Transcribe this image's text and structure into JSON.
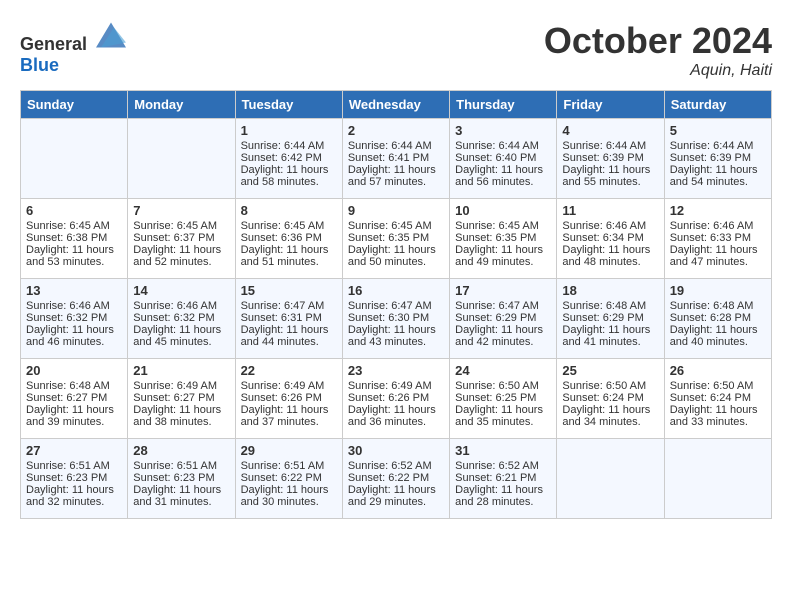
{
  "header": {
    "logo_general": "General",
    "logo_blue": "Blue",
    "month": "October 2024",
    "location": "Aquin, Haiti"
  },
  "weekdays": [
    "Sunday",
    "Monday",
    "Tuesday",
    "Wednesday",
    "Thursday",
    "Friday",
    "Saturday"
  ],
  "weeks": [
    [
      {
        "day": "",
        "empty": true
      },
      {
        "day": "",
        "empty": true
      },
      {
        "day": "1",
        "sunrise": "Sunrise: 6:44 AM",
        "sunset": "Sunset: 6:42 PM",
        "daylight": "Daylight: 11 hours and 58 minutes."
      },
      {
        "day": "2",
        "sunrise": "Sunrise: 6:44 AM",
        "sunset": "Sunset: 6:41 PM",
        "daylight": "Daylight: 11 hours and 57 minutes."
      },
      {
        "day": "3",
        "sunrise": "Sunrise: 6:44 AM",
        "sunset": "Sunset: 6:40 PM",
        "daylight": "Daylight: 11 hours and 56 minutes."
      },
      {
        "day": "4",
        "sunrise": "Sunrise: 6:44 AM",
        "sunset": "Sunset: 6:39 PM",
        "daylight": "Daylight: 11 hours and 55 minutes."
      },
      {
        "day": "5",
        "sunrise": "Sunrise: 6:44 AM",
        "sunset": "Sunset: 6:39 PM",
        "daylight": "Daylight: 11 hours and 54 minutes."
      }
    ],
    [
      {
        "day": "6",
        "sunrise": "Sunrise: 6:45 AM",
        "sunset": "Sunset: 6:38 PM",
        "daylight": "Daylight: 11 hours and 53 minutes."
      },
      {
        "day": "7",
        "sunrise": "Sunrise: 6:45 AM",
        "sunset": "Sunset: 6:37 PM",
        "daylight": "Daylight: 11 hours and 52 minutes."
      },
      {
        "day": "8",
        "sunrise": "Sunrise: 6:45 AM",
        "sunset": "Sunset: 6:36 PM",
        "daylight": "Daylight: 11 hours and 51 minutes."
      },
      {
        "day": "9",
        "sunrise": "Sunrise: 6:45 AM",
        "sunset": "Sunset: 6:35 PM",
        "daylight": "Daylight: 11 hours and 50 minutes."
      },
      {
        "day": "10",
        "sunrise": "Sunrise: 6:45 AM",
        "sunset": "Sunset: 6:35 PM",
        "daylight": "Daylight: 11 hours and 49 minutes."
      },
      {
        "day": "11",
        "sunrise": "Sunrise: 6:46 AM",
        "sunset": "Sunset: 6:34 PM",
        "daylight": "Daylight: 11 hours and 48 minutes."
      },
      {
        "day": "12",
        "sunrise": "Sunrise: 6:46 AM",
        "sunset": "Sunset: 6:33 PM",
        "daylight": "Daylight: 11 hours and 47 minutes."
      }
    ],
    [
      {
        "day": "13",
        "sunrise": "Sunrise: 6:46 AM",
        "sunset": "Sunset: 6:32 PM",
        "daylight": "Daylight: 11 hours and 46 minutes."
      },
      {
        "day": "14",
        "sunrise": "Sunrise: 6:46 AM",
        "sunset": "Sunset: 6:32 PM",
        "daylight": "Daylight: 11 hours and 45 minutes."
      },
      {
        "day": "15",
        "sunrise": "Sunrise: 6:47 AM",
        "sunset": "Sunset: 6:31 PM",
        "daylight": "Daylight: 11 hours and 44 minutes."
      },
      {
        "day": "16",
        "sunrise": "Sunrise: 6:47 AM",
        "sunset": "Sunset: 6:30 PM",
        "daylight": "Daylight: 11 hours and 43 minutes."
      },
      {
        "day": "17",
        "sunrise": "Sunrise: 6:47 AM",
        "sunset": "Sunset: 6:29 PM",
        "daylight": "Daylight: 11 hours and 42 minutes."
      },
      {
        "day": "18",
        "sunrise": "Sunrise: 6:48 AM",
        "sunset": "Sunset: 6:29 PM",
        "daylight": "Daylight: 11 hours and 41 minutes."
      },
      {
        "day": "19",
        "sunrise": "Sunrise: 6:48 AM",
        "sunset": "Sunset: 6:28 PM",
        "daylight": "Daylight: 11 hours and 40 minutes."
      }
    ],
    [
      {
        "day": "20",
        "sunrise": "Sunrise: 6:48 AM",
        "sunset": "Sunset: 6:27 PM",
        "daylight": "Daylight: 11 hours and 39 minutes."
      },
      {
        "day": "21",
        "sunrise": "Sunrise: 6:49 AM",
        "sunset": "Sunset: 6:27 PM",
        "daylight": "Daylight: 11 hours and 38 minutes."
      },
      {
        "day": "22",
        "sunrise": "Sunrise: 6:49 AM",
        "sunset": "Sunset: 6:26 PM",
        "daylight": "Daylight: 11 hours and 37 minutes."
      },
      {
        "day": "23",
        "sunrise": "Sunrise: 6:49 AM",
        "sunset": "Sunset: 6:26 PM",
        "daylight": "Daylight: 11 hours and 36 minutes."
      },
      {
        "day": "24",
        "sunrise": "Sunrise: 6:50 AM",
        "sunset": "Sunset: 6:25 PM",
        "daylight": "Daylight: 11 hours and 35 minutes."
      },
      {
        "day": "25",
        "sunrise": "Sunrise: 6:50 AM",
        "sunset": "Sunset: 6:24 PM",
        "daylight": "Daylight: 11 hours and 34 minutes."
      },
      {
        "day": "26",
        "sunrise": "Sunrise: 6:50 AM",
        "sunset": "Sunset: 6:24 PM",
        "daylight": "Daylight: 11 hours and 33 minutes."
      }
    ],
    [
      {
        "day": "27",
        "sunrise": "Sunrise: 6:51 AM",
        "sunset": "Sunset: 6:23 PM",
        "daylight": "Daylight: 11 hours and 32 minutes."
      },
      {
        "day": "28",
        "sunrise": "Sunrise: 6:51 AM",
        "sunset": "Sunset: 6:23 PM",
        "daylight": "Daylight: 11 hours and 31 minutes."
      },
      {
        "day": "29",
        "sunrise": "Sunrise: 6:51 AM",
        "sunset": "Sunset: 6:22 PM",
        "daylight": "Daylight: 11 hours and 30 minutes."
      },
      {
        "day": "30",
        "sunrise": "Sunrise: 6:52 AM",
        "sunset": "Sunset: 6:22 PM",
        "daylight": "Daylight: 11 hours and 29 minutes."
      },
      {
        "day": "31",
        "sunrise": "Sunrise: 6:52 AM",
        "sunset": "Sunset: 6:21 PM",
        "daylight": "Daylight: 11 hours and 28 minutes."
      },
      {
        "day": "",
        "empty": true
      },
      {
        "day": "",
        "empty": true
      }
    ]
  ]
}
